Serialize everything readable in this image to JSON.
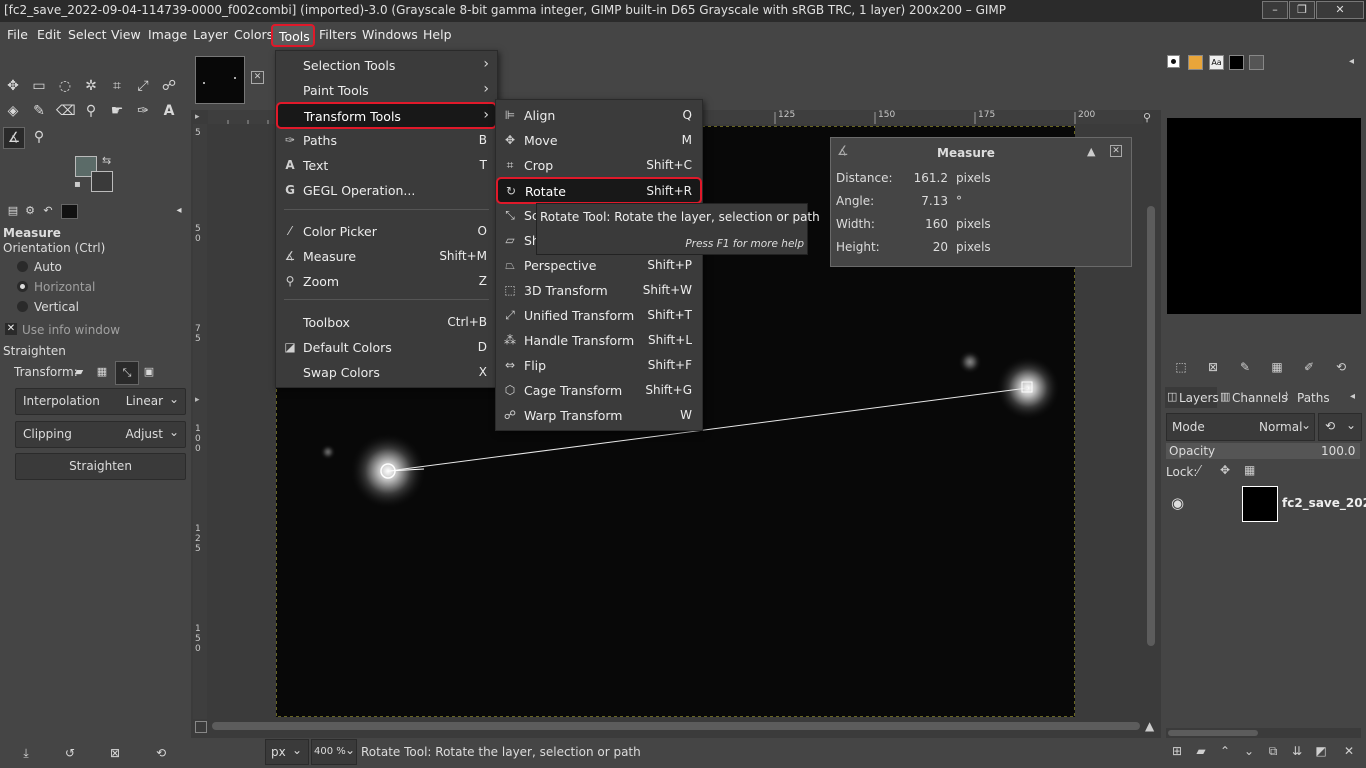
{
  "window": {
    "title": "[fc2_save_2022-09-04-114739-0000_f002combi] (imported)-3.0 (Grayscale 8-bit gamma integer, GIMP built-in D65 Grayscale with sRGB TRC, 1 layer) 200x200 – GIMP"
  },
  "menubar": [
    "File",
    "Edit",
    "Select",
    "View",
    "Image",
    "Layer",
    "Colors",
    "Tools",
    "Filters",
    "Windows",
    "Help"
  ],
  "tool_options": {
    "title": "Measure",
    "orientation_label": "Orientation  (Ctrl)",
    "orientation_options": [
      "Auto",
      "Horizontal",
      "Vertical"
    ],
    "use_info_window": "Use info window",
    "straighten_label": "Straighten",
    "transform_label": "Transform:",
    "interpolation": {
      "label": "Interpolation",
      "value": "Linear"
    },
    "clipping": {
      "label": "Clipping",
      "value": "Adjust"
    },
    "straighten_button": "Straighten"
  },
  "tools_menu": {
    "items": [
      {
        "label": "Selection Tools",
        "submenu": true,
        "icon": ""
      },
      {
        "label": "Paint Tools",
        "submenu": true,
        "icon": ""
      },
      {
        "label": "Transform Tools",
        "submenu": true,
        "icon": ""
      },
      {
        "label": "Paths",
        "shortcut": "B",
        "icon": "paths-icon"
      },
      {
        "label": "Text",
        "shortcut": "T",
        "icon": "text-icon"
      },
      {
        "label": "GEGL Operation...",
        "shortcut": "",
        "icon": "gegl-icon"
      },
      {
        "label": "Color Picker",
        "shortcut": "O",
        "icon": "color-picker-icon"
      },
      {
        "label": "Measure",
        "shortcut": "Shift+M",
        "icon": "measure-icon"
      },
      {
        "label": "Zoom",
        "shortcut": "Z",
        "icon": "zoom-icon"
      },
      {
        "label": "Toolbox",
        "shortcut": "Ctrl+B",
        "icon": ""
      },
      {
        "label": "Default Colors",
        "shortcut": "D",
        "icon": "default-colors-icon"
      },
      {
        "label": "Swap Colors",
        "shortcut": "X",
        "icon": ""
      }
    ]
  },
  "transform_menu": {
    "items": [
      {
        "label": "Align",
        "shortcut": "Q"
      },
      {
        "label": "Move",
        "shortcut": "M"
      },
      {
        "label": "Crop",
        "shortcut": "Shift+C"
      },
      {
        "label": "Rotate",
        "shortcut": "Shift+R"
      },
      {
        "label": "Sc",
        "shortcut": ""
      },
      {
        "label": "Sh",
        "shortcut": ""
      },
      {
        "label": "Perspective",
        "shortcut": "Shift+P"
      },
      {
        "label": "3D Transform",
        "shortcut": "Shift+W"
      },
      {
        "label": "Unified Transform",
        "shortcut": "Shift+T"
      },
      {
        "label": "Handle Transform",
        "shortcut": "Shift+L"
      },
      {
        "label": "Flip",
        "shortcut": "Shift+F"
      },
      {
        "label": "Cage Transform",
        "shortcut": "Shift+G"
      },
      {
        "label": "Warp Transform",
        "shortcut": "W"
      }
    ]
  },
  "tooltip": {
    "text": "Rotate Tool: Rotate the layer, selection or path",
    "help": "Press F1 for more help"
  },
  "measure_info": {
    "title": "Measure",
    "rows": [
      {
        "label": "Distance:",
        "value": "161.2",
        "unit": "pixels"
      },
      {
        "label": "Angle:",
        "value": "7.13",
        "unit": "°"
      },
      {
        "label": "Width:",
        "value": "160",
        "unit": "pixels"
      },
      {
        "label": "Height:",
        "value": "20",
        "unit": "pixels"
      }
    ]
  },
  "ruler": {
    "top_ticks": [
      "125",
      "150",
      "175",
      "200"
    ],
    "left_ticks": [
      "5",
      "5",
      "0",
      "7",
      "5",
      "1",
      "0",
      "0",
      "1",
      "2",
      "5",
      "1",
      "5",
      "0"
    ]
  },
  "statusbar": {
    "unit": "px",
    "zoom": "400 %",
    "message": "Rotate Tool: Rotate the layer, selection or path"
  },
  "layers_panel": {
    "tabs": [
      "Layers",
      "Channels",
      "Paths"
    ],
    "mode_label": "Mode",
    "mode_value": "Normal",
    "opacity_label": "Opacity",
    "opacity_value": "100.0",
    "lock_label": "Lock:",
    "layer_name": "fc2_save_202"
  },
  "colors": {
    "fg": "#5b6b68",
    "bg": "#3a3a3a",
    "highlight_red": "#e0192a"
  }
}
